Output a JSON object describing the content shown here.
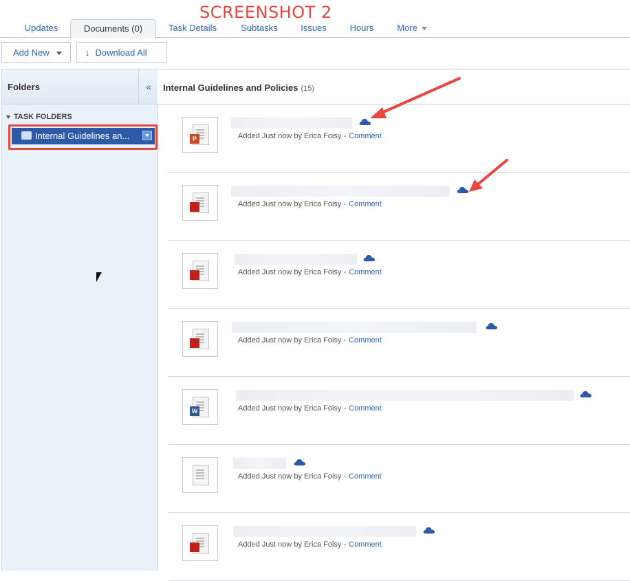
{
  "annotation_title": "SCREENSHOT 2",
  "tabs": [
    {
      "label": "Updates"
    },
    {
      "label": "Documents (0)"
    },
    {
      "label": "Task Details"
    },
    {
      "label": "Subtasks"
    },
    {
      "label": "Issues"
    },
    {
      "label": "Hours"
    },
    {
      "label": "More"
    }
  ],
  "toolbar": {
    "add_new_label": "Add New",
    "download_all_label": "Download All"
  },
  "sidebar": {
    "title": "Folders",
    "collapse_glyph": "«",
    "section_label": "TASK FOLDERS",
    "selected_folder": "Internal Guidelines an..."
  },
  "main": {
    "title": "Internal Guidelines and Policies",
    "count": "(15)"
  },
  "documents": [
    {
      "type": "ppt",
      "badge": "P",
      "meta": "Added Just now by Erica Foisy -",
      "comment": "Comment",
      "icon": "cloud-icon"
    },
    {
      "type": "pdf",
      "badge": "",
      "meta": "Added Just now by Erica Foisy -",
      "comment": "Comment",
      "icon": "cloud-icon"
    },
    {
      "type": "pdf",
      "badge": "",
      "meta": "Added Just now by Erica Foisy -",
      "comment": "Comment",
      "icon": "cloud-icon"
    },
    {
      "type": "pdf",
      "badge": "",
      "meta": "Added Just now by Erica Foisy -",
      "comment": "Comment",
      "icon": "cloud-icon"
    },
    {
      "type": "doc",
      "badge": "W",
      "meta": "Added Just now by Erica Foisy -",
      "comment": "Comment",
      "icon": "cloud-icon"
    },
    {
      "type": "generic",
      "badge": "",
      "meta": "Added Just now by Erica Foisy -",
      "comment": "Comment",
      "icon": "cloud-icon"
    },
    {
      "type": "pdf",
      "badge": "",
      "meta": "Added Just now by Erica Foisy -",
      "comment": "Comment",
      "icon": "cloud-icon"
    }
  ],
  "colors": {
    "link": "#2f67b2",
    "annotation_red": "#e8473f",
    "selected_folder_bg": "#2d5aa8",
    "cloud": "#2d5aa8"
  }
}
